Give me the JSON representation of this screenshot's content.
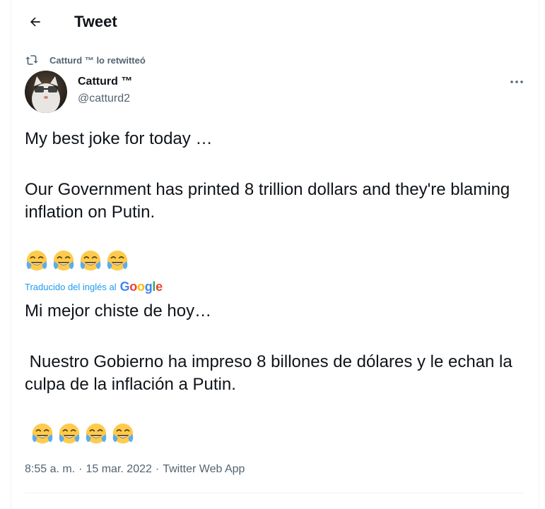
{
  "header": {
    "title": "Tweet"
  },
  "retweet": {
    "label": "Catturd ™ lo retwitteó"
  },
  "author": {
    "name": "Catturd ™",
    "handle": "@catturd2"
  },
  "tweet": {
    "line1": "My best joke for today …",
    "line2": "Our Government has printed 8 trillion dollars and they're blaming inflation on Putin.",
    "translated_label": "Traducido del inglés al",
    "translator": "Google",
    "t_line1": "Mi mejor chiste de hoy…",
    "t_line2": " Nuestro Gobierno ha impreso 8 billones de dólares y le echan la culpa de la inflación a Putin."
  },
  "meta": {
    "time": "8:55 a. m.",
    "date": "15 mar. 2022",
    "app": "Twitter Web App",
    "sep": "·"
  },
  "icons": {
    "back": "arrow-left-icon",
    "retweet": "retweet-icon",
    "more": "more-icon",
    "emoji": "face-with-tears-of-joy"
  }
}
